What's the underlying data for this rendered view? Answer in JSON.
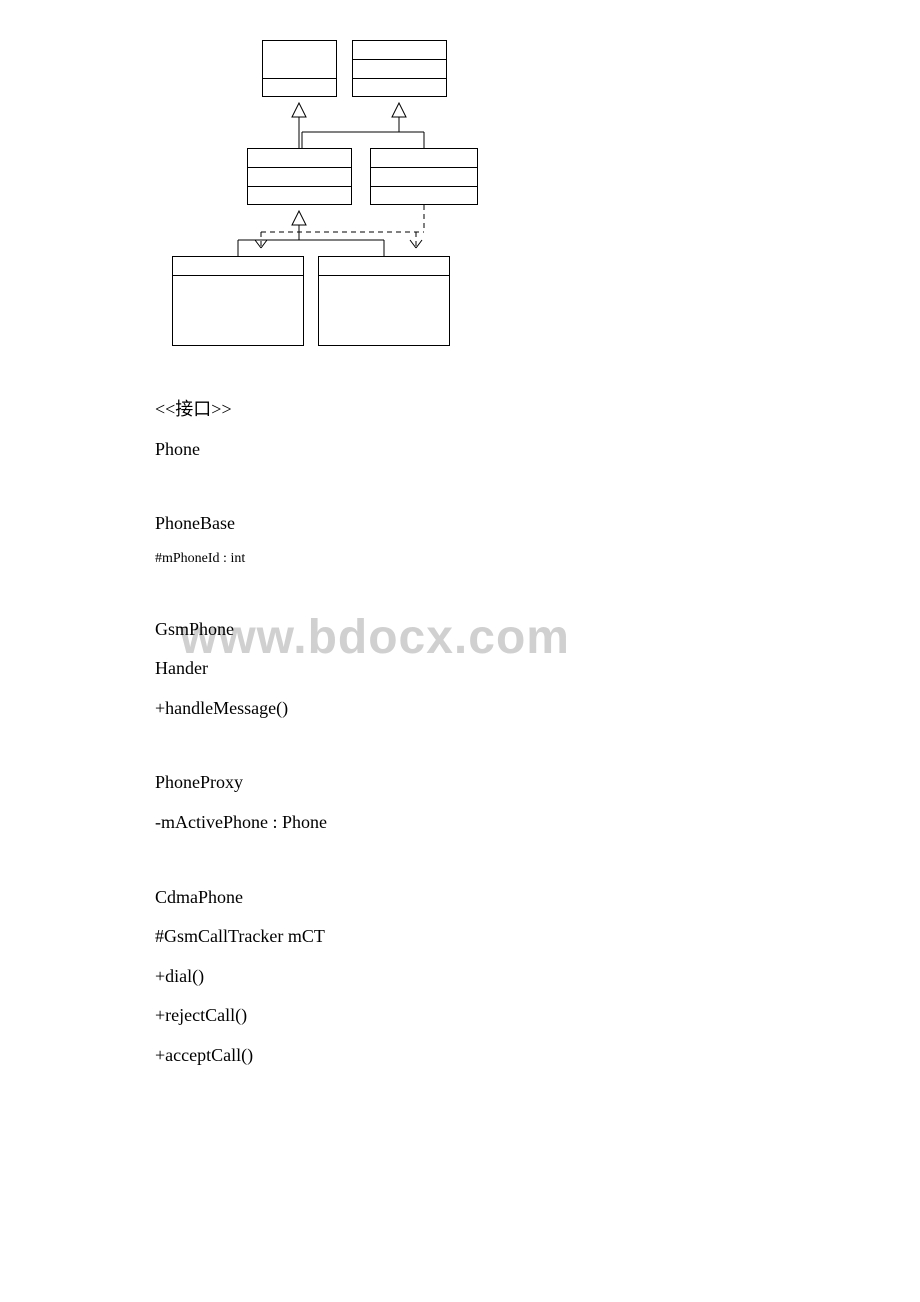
{
  "chart_data": {
    "type": "uml_class_diagram",
    "classes": [
      {
        "id": "interface",
        "stereotype": "<<接口>>",
        "name": "Phone"
      },
      {
        "id": "handler",
        "name": "Hander",
        "operations": [
          "+handleMessage()"
        ]
      },
      {
        "id": "phonebase",
        "name": "PhoneBase",
        "attributes": [
          "#mPhoneId : int"
        ]
      },
      {
        "id": "phoneproxy",
        "name": "PhoneProxy",
        "attributes": [
          "-mActivePhone : Phone"
        ]
      },
      {
        "id": "gsmphone",
        "name": "GsmPhone"
      },
      {
        "id": "cdmaphone",
        "name": "CdmaPhone",
        "attributes": [
          "#GsmCallTracker mCT"
        ],
        "operations": [
          "+dial()",
          "+rejectCall()",
          "+acceptCall()"
        ]
      }
    ],
    "relationships": [
      {
        "from": "phonebase",
        "to": "interface",
        "type": "realization"
      },
      {
        "from": "phoneproxy",
        "to": "handler",
        "type": "generalization"
      },
      {
        "from": "phonebase",
        "to": "handler",
        "type": "generalization"
      },
      {
        "from": "gsmphone",
        "to": "phonebase",
        "type": "generalization"
      },
      {
        "from": "cdmaphone",
        "to": "phonebase",
        "type": "generalization"
      },
      {
        "from": "phoneproxy",
        "to": "gsmphone",
        "type": "dependency"
      },
      {
        "from": "phoneproxy",
        "to": "cdmaphone",
        "type": "dependency"
      }
    ]
  },
  "annotations": {
    "interface_stereotype": "<<接口>>",
    "phone_name": "Phone",
    "phonebase_name": "PhoneBase",
    "phonebase_attr": "#mPhoneId : int",
    "gsmphone_name": "GsmPhone",
    "hander_name": "Hander",
    "hander_op": "+handleMessage()",
    "phoneproxy_name": "PhoneProxy",
    "phoneproxy_attr": "-mActivePhone : Phone",
    "cdmaphone_name": "CdmaPhone",
    "cdmaphone_attr": "#GsmCallTracker mCT",
    "cdmaphone_op1": "+dial()",
    "cdmaphone_op2": "+rejectCall()",
    "cdmaphone_op3": "+acceptCall()"
  },
  "watermark": "www.bdocx.com"
}
